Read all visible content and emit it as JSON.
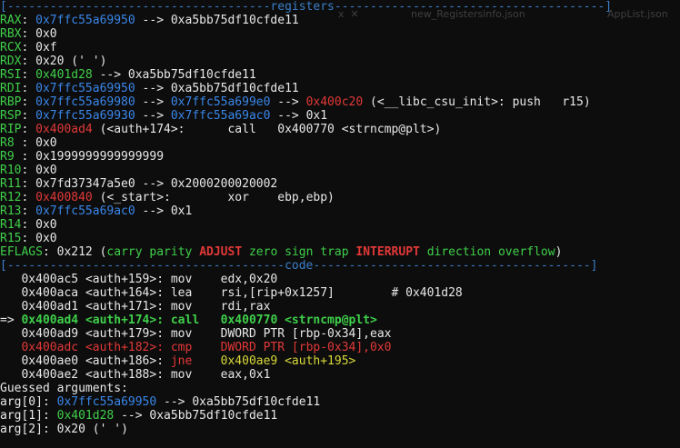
{
  "registers_bar": "[-------------------------------------registers--------------------------------------]",
  "code_bar": "[---------------------------------------code---------------------------------------]",
  "regs": [
    {
      "name": "RAX",
      "pad": "",
      "val": "0x7ffc55a69950",
      "chain": " --> 0xa5bb75df10cfde11",
      "chain2": "",
      "chain3": ""
    },
    {
      "name": "RBX",
      "pad": "",
      "val": "0x0"
    },
    {
      "name": "RCX",
      "pad": "",
      "val": "0xf"
    },
    {
      "name": "RDX",
      "pad": "",
      "val": "0x20 (' ')"
    },
    {
      "name": "RSI",
      "val": "0x401d28",
      "chain": " --> 0xa5bb75df10cfde11"
    },
    {
      "name": "RDI",
      "val": "0x7ffc55a69950",
      "chain": " --> 0xa5bb75df10cfde11"
    },
    {
      "name": "RBP",
      "val": "0x7ffc55a69980",
      "mid": " --> ",
      "val2": "0x7ffc55a699e0",
      "mid2": " --> ",
      "val3": "0x400c20",
      "tail": " (<__libc_csu_init>: push   r15)"
    },
    {
      "name": "RSP",
      "val": "0x7ffc55a69930",
      "mid": " --> ",
      "val2": "0x7ffc55a69ac0",
      "tail": " --> 0x1"
    },
    {
      "name": "RIP",
      "val": "0x400ad4",
      "tail": " (<auth+174>:      call   0x400770 <strncmp@plt>)"
    },
    {
      "name": "R8 ",
      "val": "0x0"
    },
    {
      "name": "R9 ",
      "val": "0x1999999999999999"
    },
    {
      "name": "R10",
      "val": "0x0"
    },
    {
      "name": "R11",
      "val": "0x7fd37347a5e0",
      "tail": " --> 0x2000200020002"
    },
    {
      "name": "R12",
      "val": "0x400840",
      "tail": " (<_start>:        xor    ebp,ebp)"
    },
    {
      "name": "R13",
      "val": "0x7ffc55a69ac0",
      "tail": " --> 0x1"
    },
    {
      "name": "R14",
      "val": "0x0"
    },
    {
      "name": "R15",
      "val": "0x0"
    }
  ],
  "eflags": {
    "label": "EFLAGS",
    "value": "0x212",
    "open": " (",
    "carry": "carry",
    "parity": "parity",
    "adjust": "ADJUST",
    "zero": "zero",
    "sign": "sign",
    "trap": "trap",
    "interrupt": "INTERRUPT",
    "direction": "direction",
    "overflow": "overflow",
    "close": ")"
  },
  "code": [
    {
      "prefix": "   ",
      "addr": "0x400ac5",
      "sym": "<auth+159>:",
      "op": "mov",
      "args": "    edx,0x20"
    },
    {
      "prefix": "   ",
      "addr": "0x400aca",
      "sym": "<auth+164>:",
      "op": "lea",
      "args": "    rsi,[rip+0x1257]        # 0x401d28"
    },
    {
      "prefix": "   ",
      "addr": "0x400ad1",
      "sym": "<auth+171>:",
      "op": "mov",
      "args": "    rdi,rax"
    },
    {
      "prefix": "=> ",
      "addr": "0x400ad4",
      "sym": "<auth+174>:",
      "op": "call",
      "args": "   0x400770 <strncmp@plt>",
      "current": true
    },
    {
      "prefix": "   ",
      "addr": "0x400ad9",
      "sym": "<auth+179>:",
      "op": "mov",
      "args": "    DWORD PTR [rbp-0x34],eax"
    },
    {
      "prefix": "   ",
      "addr": "0x400adc",
      "sym": "<auth+182>:",
      "op": "cmp",
      "args": "    DWORD PTR [rbp-0x34],0x0",
      "red": true
    },
    {
      "prefix": "   ",
      "addr": "0x400ae0",
      "sym": "<auth+186>:",
      "op": "jne",
      "args": "    0x400ae9 <auth+195>",
      "jump": true
    },
    {
      "prefix": "   ",
      "addr": "0x400ae2",
      "sym": "<auth+188>:",
      "op": "mov",
      "args": "    eax,0x1"
    }
  ],
  "guessed_label": "Guessed arguments:",
  "args": [
    {
      "name": "arg[0]",
      "val": "0x7ffc55a69950",
      "chain": " --> 0xa5bb75df10cfde11"
    },
    {
      "name": "arg[1]",
      "val": "0x401d28",
      "chain": " --> 0xa5bb75df10cfde11"
    },
    {
      "name": "arg[2]",
      "val": "0x20 (' ')",
      "chain": ""
    }
  ],
  "ghost": {
    "tab1": "x  ✕",
    "tab2": "new_Registersinfo.json",
    "tab3": "AppList.json"
  },
  "colors": {
    "background": "#0d0d0d",
    "separator": "#3b7ec8",
    "register_name": "#3fcf4a",
    "stack_value": "#3a86e8",
    "code_value": "#e23838",
    "current_instr": "#d8d83a"
  }
}
